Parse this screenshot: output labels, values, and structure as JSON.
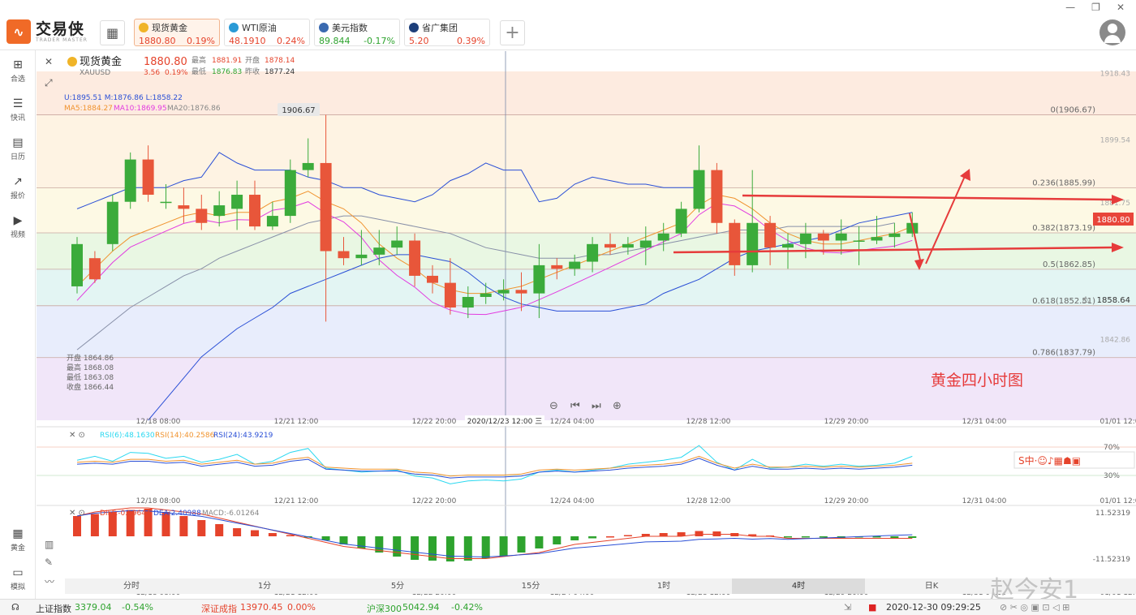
{
  "app": {
    "name": "交易侠",
    "sub": "TRADER MASTER"
  },
  "tickers": [
    {
      "name": "现货黄金",
      "price": "1880.80",
      "pct": "0.19%",
      "dir": "up",
      "color": "#f0b428"
    },
    {
      "name": "WTI原油",
      "price": "48.1910",
      "pct": "0.24%",
      "dir": "up",
      "color": "#2a9ad6"
    },
    {
      "name": "美元指数",
      "price": "89.844",
      "pct": "-0.17%",
      "dir": "dn",
      "color": "#3a6ab0"
    },
    {
      "name": "省广集团",
      "price": "5.20",
      "pct": "0.39%",
      "dir": "up",
      "color": "#1d3f7a"
    }
  ],
  "sidebar": [
    "合选",
    "快讯",
    "日历",
    "报价",
    "视频",
    "黄金",
    "模拟"
  ],
  "header": {
    "name": "现货黄金",
    "code": "XAUUSD",
    "price": "1880.80",
    "change": "3.56",
    "change_pct": "0.19%",
    "high_l": "最高",
    "high": "1881.91",
    "open_l": "开盘",
    "open": "1878.14",
    "low_l": "最低",
    "low": "1876.83",
    "prev_l": "昨收",
    "prev": "1877.24"
  },
  "indicators": {
    "boll": "U:1895.51  M:1876.86  L:1858.22",
    "ma5": "MA5:1884.27",
    "ma10": "MA10:1869.95",
    "ma20": "MA20:1876.86",
    "rsi": [
      "RSI(6):48.1630",
      "RSI(14):40.2586",
      "RSI(24):43.9219"
    ],
    "macd": [
      "DIFF:-0.59644",
      "DEA:2.40988",
      "MACD:-6.01264"
    ]
  },
  "ohlc_box": [
    "开盘 1864.86",
    "最高 1868.08",
    "最低 1863.08",
    "收盘 1866.44"
  ],
  "annotation": "黄金四小时图",
  "crosshair_label": "2020/12/23 12:00 三",
  "current_price": "1880.80",
  "alert_price": "1858.64",
  "rsi_levels": [
    "70%",
    "30%"
  ],
  "macd_levels": [
    "11.52319",
    "-11.52319"
  ],
  "tabs": [
    "分时",
    "1分",
    "5分",
    "15分",
    "1时",
    "4时",
    "日K"
  ],
  "selected_tab": "4时",
  "watermark": "赵今安1",
  "bottom": {
    "items": [
      {
        "label": "上证指数",
        "val": "3379.04",
        "pct": "-0.54%",
        "dir": "dn"
      },
      {
        "label": "深证成指",
        "val": "13970.45",
        "pct": "0.00%",
        "dir": "up"
      },
      {
        "label": "沪深300",
        "val": "5042.94",
        "pct": "-0.42%",
        "dir": "dn"
      }
    ],
    "datetime": "2020-12-30 09:29:25"
  },
  "chart_data": {
    "type": "candlestick",
    "x_ticks": [
      "12/18 08:00",
      "12/21 12:00",
      "12/22 20:00",
      "12/24 04:00",
      "12/28 12:00",
      "12/29 20:00",
      "12/31 04:00",
      "01/01 12:0"
    ],
    "y_ticks": [
      "1918.43",
      "1899.54",
      "1881.75",
      "1842.86"
    ],
    "ylim": [
      1820,
      1919
    ],
    "high_label": "1906.67",
    "fib": [
      {
        "label": "0(1906.67)",
        "value": 1906.67
      },
      {
        "label": "0.236(1885.99)",
        "value": 1885.99
      },
      {
        "label": "0.382(1873.19)",
        "value": 1873.19
      },
      {
        "label": "0.5(1862.85)",
        "value": 1862.85
      },
      {
        "label": "0.618(1852.51)",
        "value": 1852.51
      },
      {
        "label": "0.786(1837.79)",
        "value": 1837.79
      }
    ],
    "candles": [
      [
        1858,
        1870,
        1872,
        1856
      ],
      [
        1866,
        1860,
        1868,
        1859
      ],
      [
        1870,
        1882,
        1884,
        1868
      ],
      [
        1882,
        1894,
        1896,
        1880
      ],
      [
        1894,
        1884,
        1898,
        1882
      ],
      [
        1882,
        1882,
        1887,
        1880
      ],
      [
        1881,
        1880,
        1886,
        1876
      ],
      [
        1880,
        1876,
        1884,
        1874
      ],
      [
        1878,
        1881,
        1885,
        1875
      ],
      [
        1880,
        1884,
        1888,
        1874
      ],
      [
        1884,
        1875,
        1888,
        1874
      ],
      [
        1875,
        1878,
        1882,
        1874
      ],
      [
        1878,
        1891,
        1894,
        1876
      ],
      [
        1891,
        1893,
        1900,
        1889
      ],
      [
        1893,
        1868,
        1906.67,
        1848
      ],
      [
        1868,
        1866,
        1872,
        1864
      ],
      [
        1866,
        1867,
        1874,
        1864
      ],
      [
        1867,
        1869,
        1874,
        1864
      ],
      [
        1869,
        1871,
        1875,
        1867
      ],
      [
        1871,
        1861,
        1873,
        1858
      ],
      [
        1861,
        1859,
        1864,
        1856
      ],
      [
        1859,
        1852,
        1866,
        1850
      ],
      [
        1852,
        1855,
        1858,
        1849
      ],
      [
        1855,
        1856,
        1859,
        1853
      ],
      [
        1856,
        1857,
        1860,
        1854
      ],
      [
        1857,
        1856,
        1862,
        1851
      ],
      [
        1856,
        1864,
        1870,
        1849
      ],
      [
        1864,
        1863,
        1866,
        1860
      ],
      [
        1863,
        1865,
        1867,
        1861
      ],
      [
        1865,
        1870,
        1872,
        1862
      ],
      [
        1870,
        1869,
        1873,
        1867
      ],
      [
        1869,
        1870,
        1872,
        1867
      ],
      [
        1869,
        1871,
        1875,
        1864
      ],
      [
        1871,
        1873,
        1876,
        1868
      ],
      [
        1873,
        1880,
        1882,
        1872
      ],
      [
        1880,
        1891,
        1898,
        1879
      ],
      [
        1891,
        1876,
        1893,
        1873
      ],
      [
        1876,
        1864,
        1877,
        1861
      ],
      [
        1864,
        1876,
        1891,
        1862
      ],
      [
        1876,
        1869,
        1878,
        1864
      ],
      [
        1869,
        1870,
        1873,
        1863
      ],
      [
        1870,
        1873,
        1876,
        1866
      ],
      [
        1873,
        1871,
        1874,
        1867
      ],
      [
        1871,
        1873,
        1877,
        1867
      ],
      [
        1871,
        1871,
        1875,
        1864
      ],
      [
        1871,
        1872,
        1878,
        1870
      ],
      [
        1872,
        1873,
        1876,
        1869
      ],
      [
        1873,
        1876,
        1879,
        1872
      ]
    ],
    "bb_upper": [
      1880,
      1882,
      1884,
      1886,
      1886,
      1886,
      1888,
      1889,
      1896,
      1893,
      1891,
      1891,
      1891,
      1889,
      1888,
      1886,
      1886,
      1884,
      1883,
      1882,
      1884,
      1888,
      1890,
      1893,
      1891,
      1891,
      1882,
      1883,
      1887,
      1889,
      1888,
      1887,
      1887,
      1886,
      1886,
      1886
    ],
    "ma5": [
      1858,
      1863,
      1868,
      1872,
      1874,
      1876,
      1878,
      1879,
      1878,
      1879,
      1879,
      1882,
      1883,
      1885,
      1882,
      1880,
      1876,
      1870,
      1866,
      1863,
      1859,
      1857,
      1856,
      1856,
      1857,
      1858,
      1860,
      1862,
      1864,
      1866,
      1868,
      1870,
      1872,
      1874,
      1876,
      1881,
      1884,
      1883,
      1880,
      1876,
      1873,
      1871,
      1870,
      1870,
      1871,
      1872,
      1873,
      1875
    ],
    "rsi6": [
      56,
      60,
      55,
      64,
      63,
      58,
      60,
      54,
      57,
      62,
      52,
      55,
      64,
      68,
      48,
      46,
      44,
      45,
      46,
      40,
      38,
      32,
      35,
      36,
      35,
      37,
      44,
      46,
      44,
      46,
      48,
      52,
      54,
      56,
      59,
      71,
      54,
      46,
      57,
      48,
      49,
      52,
      50,
      52,
      50,
      51,
      53,
      60
    ],
    "rsi14": [
      54,
      55,
      54,
      57,
      57,
      55,
      56,
      52,
      54,
      56,
      52,
      53,
      57,
      59,
      49,
      48,
      47,
      47,
      47,
      44,
      43,
      40,
      41,
      41,
      41,
      42,
      46,
      47,
      46,
      47,
      48,
      50,
      51,
      52,
      54,
      60,
      53,
      48,
      52,
      49,
      49,
      50,
      49,
      50,
      49,
      50,
      51,
      53
    ],
    "macd_hist": [
      5,
      5.5,
      6,
      6.5,
      6.8,
      6,
      5,
      4,
      3,
      2,
      1.5,
      0.8,
      0.3,
      -0.2,
      -1,
      -2,
      -3,
      -4,
      -5,
      -5.8,
      -6,
      -6.2,
      -6,
      -5.5,
      -5,
      -4,
      -3,
      -2,
      -1,
      -0.5,
      0,
      0.3,
      0.6,
      0.8,
      1,
      1.3,
      1.2,
      0.8,
      0.5,
      0.2,
      -0.1,
      -0.2,
      -0.3,
      -0.4,
      -0.3,
      -0.3,
      -0.4,
      -0.4
    ]
  }
}
